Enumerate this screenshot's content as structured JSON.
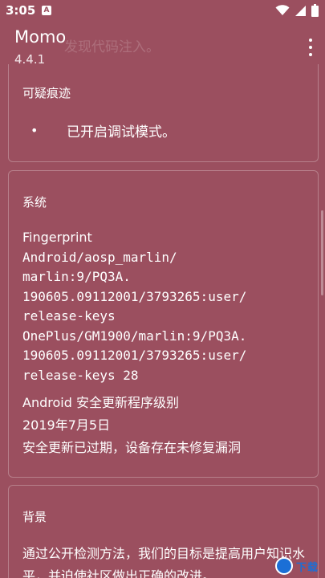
{
  "status_bar": {
    "time": "3:05",
    "notification_icon_label": "A",
    "icons": [
      "notification-a-icon",
      "wifi-icon",
      "signal-icon",
      "battery-icon"
    ]
  },
  "header": {
    "title": "Momo",
    "version": "4.4.1",
    "ghost_text": "发现代码注入。"
  },
  "sections": {
    "suspicious": {
      "title": "可疑痕迹",
      "items": [
        "已开启调试模式。"
      ]
    },
    "system": {
      "title": "系统",
      "fingerprint_label": "Fingerprint",
      "fingerprint_value": "Android/aosp_marlin/\nmarlin:9/PQ3A.\n190605.09112001/3793265:user/\nrelease-keys\nOnePlus/GM1900/marlin:9/PQ3A.\n190605.09112001/3793265:user/\nrelease-keys 28",
      "security_patch_label": "Android 安全更新程序级别",
      "security_patch_date": "2019年7月5日",
      "security_patch_note": "安全更新已过期，设备存在未修复漏洞"
    },
    "background": {
      "title": "背景",
      "text": "通过公开检测方法，我们的目标是提高用户知识水平，并迫使社区做出正确的改进。"
    }
  },
  "watermark": {
    "text": "下载"
  },
  "colors": {
    "background": "#9b4f5f",
    "card_border": "rgba(255,255,255,0.28)",
    "text": "#ffffff"
  }
}
